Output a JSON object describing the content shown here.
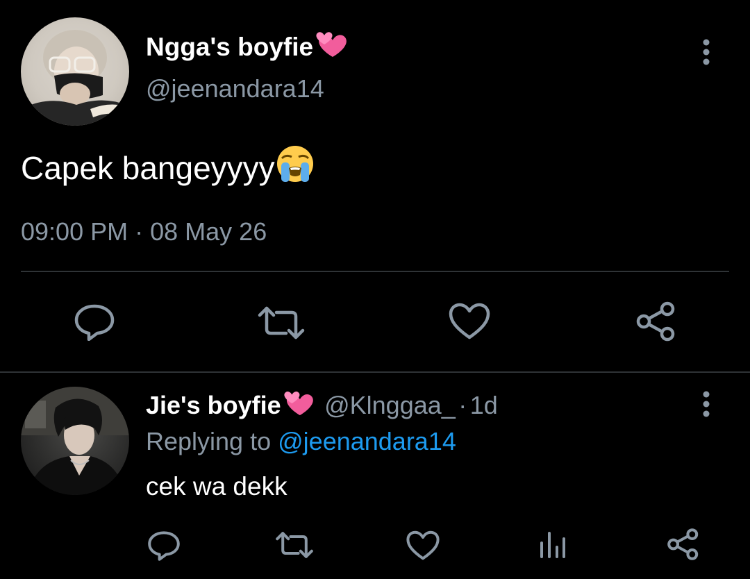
{
  "main_tweet": {
    "display_name": "Ngga's boyfie",
    "handle": "@jeenandara14",
    "text": "Capek bangeyyyy",
    "time": "09:00 PM",
    "separator": "·",
    "date": "08 May 26",
    "name_emoji": "two-hearts-icon",
    "text_emoji": "loudly-crying-face-icon"
  },
  "actions": [
    "reply-icon",
    "retweet-icon",
    "like-icon",
    "share-icon"
  ],
  "reply": {
    "display_name": "Jie's boyfie",
    "handle": "@Klnggaa_",
    "separator": "·",
    "time_ago": "1d",
    "replying_prefix": "Replying to",
    "replying_to": "@jeenandara14",
    "text": "cek wa dekk",
    "actions": [
      "reply-icon",
      "retweet-icon",
      "like-icon",
      "analytics-icon",
      "share-icon"
    ]
  },
  "colors": {
    "background": "#000000",
    "primary_text": "#ffffff",
    "secondary_text": "#8b98a5",
    "link": "#1d9bf0",
    "divider": "#2f3336",
    "heart_emoji": "#f25d9c"
  }
}
